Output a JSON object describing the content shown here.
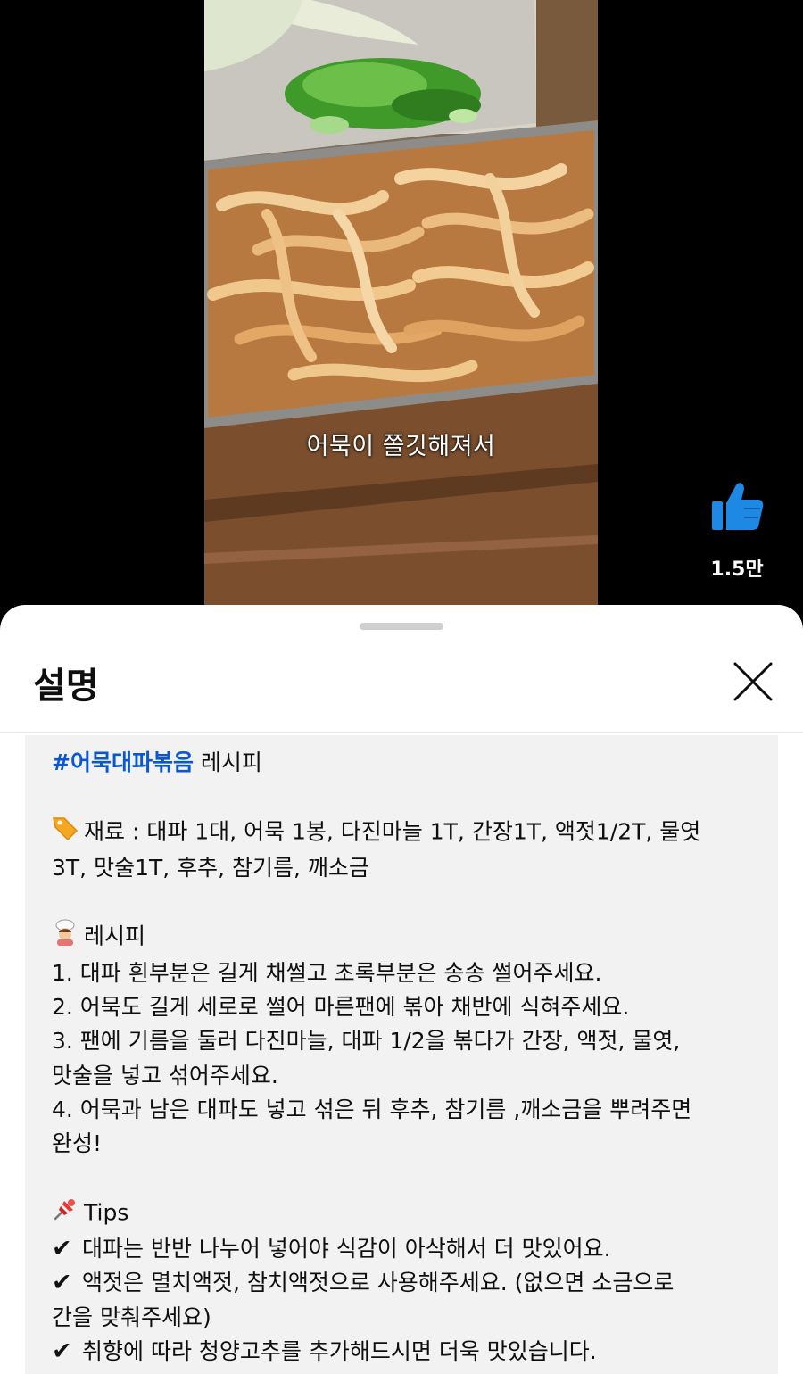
{
  "video": {
    "caption": "어묵이 쫄깃해져서",
    "like_count": "1.5만"
  },
  "sheet": {
    "title": "설명"
  },
  "description": {
    "hashtag": "#어묵대파볶음",
    "title_suffix": " 레시피",
    "ingredients_line1": "재료 : 대파 1대, 어묵 1봉, 다진마늘 1T, 간장1T, 액젓1/2T, 물엿",
    "ingredients_line2": "3T, 맛술1T, 후추, 참기름, 깨소금",
    "recipe_header": "레시피",
    "steps": [
      "1. 대파 흰부분은 길게 채썰고 초록부분은 송송 썰어주세요.",
      "2. 어묵도 길게 세로로 썰어 마른팬에 볶아 채반에 식혀주세요.",
      "3. 팬에 기름을 둘러 다진마늘, 대파 1/2을 볶다가 간장, 액젓, 물엿,",
      "맛술을 넣고 섞어주세요.",
      "4. 어묵과 남은 대파도 넣고 섞은 뒤 후추, 참기름 ,깨소금을 뿌려주면",
      "완성!"
    ],
    "tips_header": "Tips",
    "tips": [
      "대파는 반반 나누어 넣어야 식감이 아삭해서 더 맛있어요.",
      "액젓은 멸치액젓, 참치액젓으로 사용해주세요. (없으면 소금으로",
      "간을 맞춰주세요)",
      "취향에 따라 청양고추를 추가해드시면 더욱 맛있습니다."
    ]
  },
  "icons": {
    "like": "thumbs-up-icon",
    "close": "close-icon",
    "ingredients": "label-tag-icon",
    "recipe": "cook-icon",
    "tips": "pushpin-icon",
    "check": "check-mark-icon"
  },
  "colors": {
    "hashtag": "#0b57d0",
    "like_icon": "#1e88e5",
    "desc_background": "#f2f2f2"
  }
}
